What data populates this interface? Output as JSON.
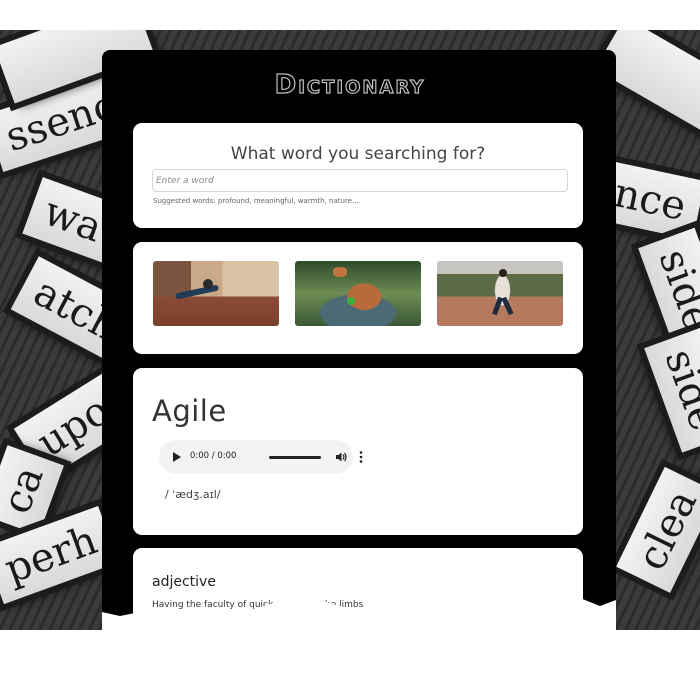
{
  "app": {
    "title": "Dictionary"
  },
  "background_words": [
    "ssence",
    "wa",
    "atch",
    "upon",
    "ca",
    "perh",
    "nce",
    "side",
    "side",
    "clea"
  ],
  "search": {
    "heading": "What word you searching for?",
    "placeholder": "Enter a word",
    "suggested": "Suggested words: profound, meaningful, warmth, nature...."
  },
  "images": [
    {
      "name": "thumb-brick-wall-jumper"
    },
    {
      "name": "thumb-dog-leaping"
    },
    {
      "name": "thumb-runner-on-path"
    }
  ],
  "word": {
    "title": "Agile",
    "audio_time": "0:00 / 0:00",
    "phonetic": "/ ˈædʒ.aɪl/"
  },
  "meaning": {
    "part_of_speech": "adjective",
    "definition_visible": "Having the faculty of quick motion in the limbs"
  },
  "colors": {
    "panel": "#000000",
    "card": "#ffffff",
    "text": "#333333",
    "audio_bg": "#f1f3f4"
  }
}
